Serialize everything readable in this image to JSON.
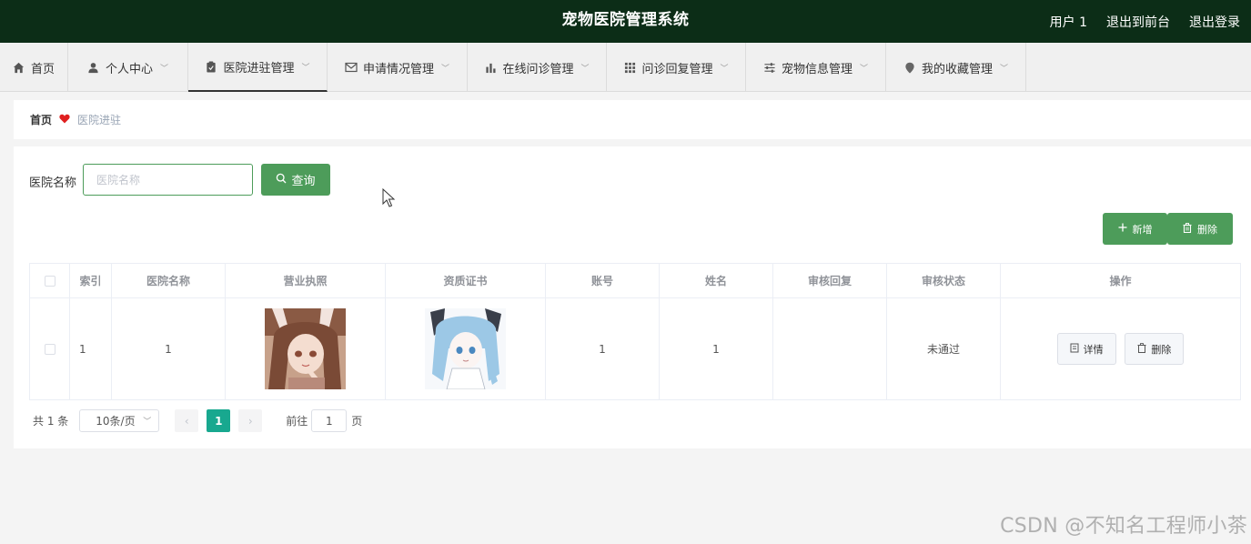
{
  "header": {
    "title": "宠物医院管理系统",
    "links": [
      {
        "name": "user",
        "label": "用户 1"
      },
      {
        "name": "front",
        "label": "退出到前台"
      },
      {
        "name": "logout",
        "label": "退出登录"
      }
    ]
  },
  "nav": {
    "items": [
      {
        "label": "首页",
        "icon": "home-icon",
        "dropdown": false,
        "active": false
      },
      {
        "label": "个人中心",
        "icon": "user-icon",
        "dropdown": true,
        "active": false
      },
      {
        "label": "医院进驻管理",
        "icon": "clipboard-icon",
        "dropdown": true,
        "active": true
      },
      {
        "label": "申请情况管理",
        "icon": "mail-icon",
        "dropdown": true,
        "active": false
      },
      {
        "label": "在线问诊管理",
        "icon": "bar-chart-icon",
        "dropdown": true,
        "active": false
      },
      {
        "label": "问诊回复管理",
        "icon": "grid-icon",
        "dropdown": true,
        "active": false
      },
      {
        "label": "宠物信息管理",
        "icon": "sliders-icon",
        "dropdown": true,
        "active": false
      },
      {
        "label": "我的收藏管理",
        "icon": "location-icon",
        "dropdown": true,
        "active": false
      }
    ]
  },
  "breadcrumb": {
    "home": "首页",
    "current": "医院进驻"
  },
  "search": {
    "label": "医院名称",
    "placeholder": "医院名称",
    "value": "",
    "button": "查询"
  },
  "actions": {
    "add": "新增",
    "delete": "删除"
  },
  "table": {
    "columns": [
      "索引",
      "医院名称",
      "营业执照",
      "资质证书",
      "账号",
      "姓名",
      "审核回复",
      "审核状态",
      "操作"
    ],
    "rows": [
      {
        "index": "1",
        "hospital_name": "1",
        "account": "1",
        "name": "1",
        "review_reply": "",
        "review_status": "未通过",
        "detail_btn": "详情",
        "delete_btn": "删除"
      }
    ]
  },
  "pager": {
    "total": "共 1 条",
    "page_size": "10条/页",
    "current_page": "1",
    "goto_label": "前往",
    "goto_value": "1",
    "page_unit": "页"
  },
  "watermark": "CSDN @不知名工程师小茶",
  "colors": {
    "header_bg": "#0c2d17",
    "accent": "#4d9c5a",
    "page_active": "#18a88f"
  }
}
